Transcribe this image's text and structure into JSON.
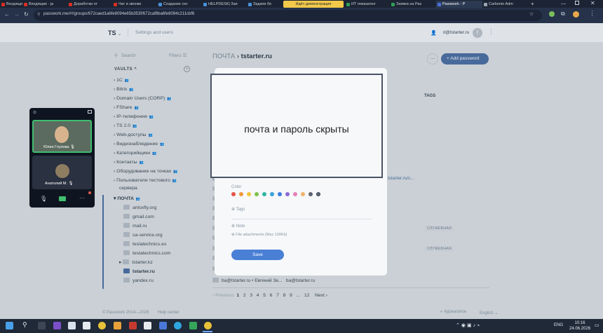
{
  "browser": {
    "tabs": [
      {
        "label": "Входящие - ja",
        "color": "#d93025"
      },
      {
        "label": "Доработки от",
        "color": "#d93025"
      },
      {
        "label": "Чат и звонки",
        "color": "#d93025"
      },
      {
        "label": "Создание сес",
        "color": "#4a90d9"
      },
      {
        "label": "HELPDESK| Зая",
        "color": "#4a90d9"
      },
      {
        "label": "Задачи бе",
        "color": "#4a90d9"
      },
      {
        "label": "ИТ показател",
        "color": "#2e9d57"
      },
      {
        "label": "Заявка на Раз",
        "color": "#2e9d57"
      },
      {
        "label": "Passwork - Р",
        "color": "#4a6fd9"
      },
      {
        "label": "Carbonio Adm",
        "color": "#9aa5b3"
      }
    ],
    "tab_tooltip": "Идёт демонстрация",
    "url": "passwork.me/#!/groups/672caed1a6fe8094e65b353f/672caf8ba6fe8094c211cbf6"
  },
  "app": {
    "org": "TS",
    "settings": "Settings and users",
    "user_email": "it@tstarter.ru",
    "avatar_letter": "I",
    "search_placeholder": "Search",
    "filters": "Filters",
    "vaults_title": "VAULTS",
    "vaults": [
      "1C",
      "Bitrix",
      "Domain Users (CORP)",
      "FShare",
      "IP-телефония",
      "TS 2.0",
      "Web-доступы",
      "Видеонаблюдение",
      "Категорийщики",
      "Контакты",
      "Оборудование на точках",
      "Пользователи тестового",
      "сервера",
      "ПОЧТА"
    ],
    "folders": [
      "anloxfly.org",
      "gmail.com",
      "mail.ru",
      "sa-service.org",
      "teslatechnics.es",
      "testatechnics.com",
      "tstarter.kz",
      "tstarter.ru",
      "yandex.ru"
    ],
    "breadcrumb_root": "ПОЧТА",
    "breadcrumb_current": "tstarter.ru",
    "add_password": "Add password",
    "tags_header": "TAGS",
    "link_text": "tstarter.ru/c...",
    "tag_badge": "СЛУЖЕБНАЯ",
    "last_row": {
      "login": "ba@tstarter.ru",
      "name": "Евгений Зе...",
      "email": "ba@tstarter.ru"
    },
    "pagination": {
      "prev": "Previous",
      "pages": [
        "1",
        "2",
        "3",
        "4",
        "5",
        "6",
        "7",
        "8",
        "9",
        "...",
        "12"
      ],
      "next": "Next"
    },
    "footer_copy": "© Passwork 2014—2026",
    "footer_help": "Help center",
    "appearance": "Appearance",
    "language": "English"
  },
  "modal": {
    "hidden_notice": "почта и пароль скрыты",
    "color_label": "Color",
    "colors": [
      "#e8504a",
      "#f0973a",
      "#f3c53d",
      "#7ec24a",
      "#2fb6a1",
      "#39a2d8",
      "#3e7de0",
      "#8a6ad8",
      "#e87fb8",
      "#f2b36a",
      "#5c6470"
    ],
    "tags_label": "Tags",
    "note_label": "Note",
    "attach_label": "File attachments (Max 100Kb)",
    "save": "Save"
  },
  "meet": {
    "user1": "Юлия Глухова",
    "user2": "Анатолий М."
  },
  "taskbar": {
    "lang": "ENG",
    "time": "10:16",
    "date": "24.06.2026"
  }
}
